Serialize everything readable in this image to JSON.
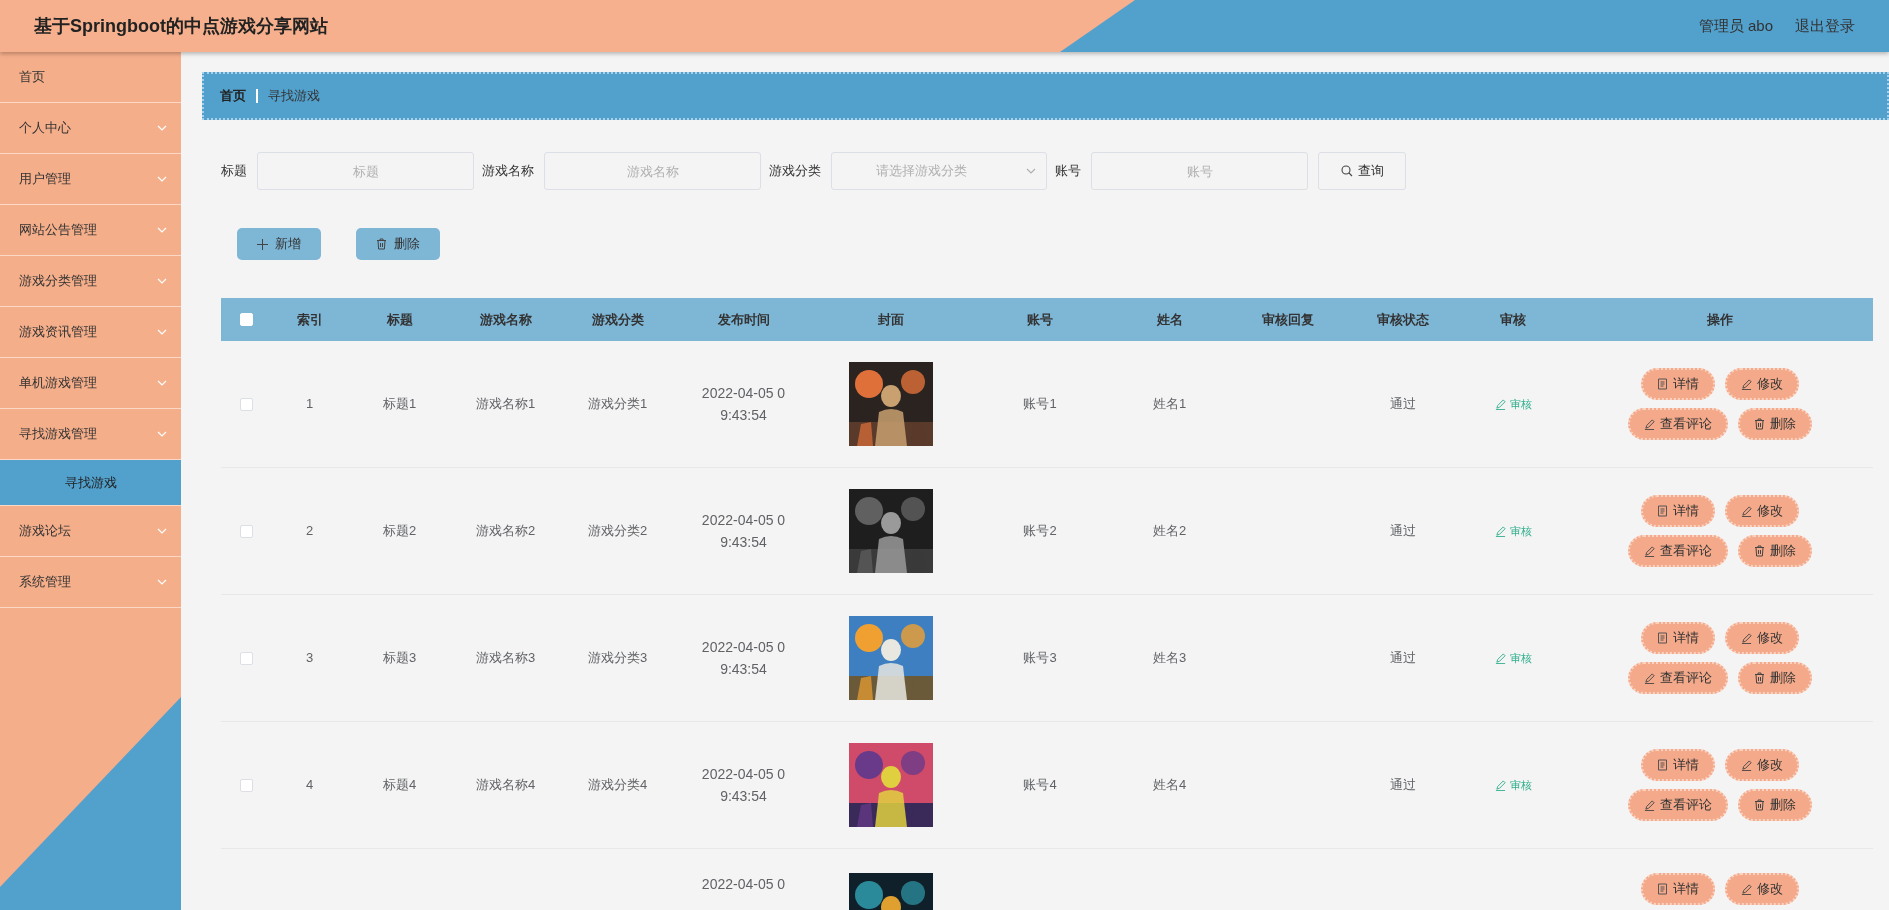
{
  "header": {
    "title": "基于Springboot的中点游戏分享网站",
    "user": "管理员 abo",
    "logout": "退出登录"
  },
  "sidebar": {
    "items": [
      {
        "label": "首页",
        "kind": "link"
      },
      {
        "label": "个人中心",
        "kind": "menu"
      },
      {
        "label": "用户管理",
        "kind": "menu"
      },
      {
        "label": "网站公告管理",
        "kind": "menu"
      },
      {
        "label": "游戏分类管理",
        "kind": "menu"
      },
      {
        "label": "游戏资讯管理",
        "kind": "menu"
      },
      {
        "label": "单机游戏管理",
        "kind": "menu"
      },
      {
        "label": "寻找游戏管理",
        "kind": "menu",
        "children": [
          {
            "label": "寻找游戏",
            "selected": true
          }
        ]
      },
      {
        "label": "游戏论坛",
        "kind": "menu"
      },
      {
        "label": "系统管理",
        "kind": "menu"
      }
    ]
  },
  "breadcrumb": [
    {
      "label": "首页",
      "current": false
    },
    {
      "label": "寻找游戏",
      "current": true
    }
  ],
  "search": {
    "fields": [
      {
        "label": "标题",
        "placeholder": "标题",
        "kind": "input"
      },
      {
        "label": "游戏名称",
        "placeholder": "游戏名称",
        "kind": "input"
      },
      {
        "label": "游戏分类",
        "placeholder": "请选择游戏分类",
        "kind": "select"
      },
      {
        "label": "账号",
        "placeholder": "账号",
        "kind": "input"
      }
    ],
    "button": "查询"
  },
  "actions": [
    {
      "label": "新增",
      "kind": "add"
    },
    {
      "label": "删除",
      "kind": "delete"
    }
  ],
  "table": {
    "select_all_checked": false,
    "columns": [
      "索引",
      "标题",
      "游戏名称",
      "游戏分类",
      "发布时间",
      "封面",
      "账号",
      "姓名",
      "审核回复",
      "审核状态",
      "审核",
      "操作"
    ],
    "rows": [
      {
        "checked": false,
        "index": "1",
        "title": "标题1",
        "name": "游戏名称1",
        "category": "游戏分类1",
        "date_lines": [
          "2022-04-05 0",
          "9:43:54"
        ],
        "cover": {
          "kind": "picture"
        },
        "account": "账号1",
        "person": "姓名1",
        "status": "通过",
        "review": "审核",
        "buttons": [
          {
            "kind": "detail",
            "label": "详情"
          },
          {
            "kind": "edit",
            "label": "修改"
          },
          {
            "kind": "edit",
            "label": "查看评论"
          },
          {
            "kind": "delete",
            "label": "删除"
          }
        ]
      },
      {
        "checked": false,
        "index": "2",
        "title": "标题2",
        "name": "游戏名称2",
        "category": "游戏分类2",
        "date_lines": [
          "2022-04-05 0",
          "9:43:54"
        ],
        "cover": {
          "kind": "picture"
        },
        "account": "账号2",
        "person": "姓名2",
        "status": "通过",
        "review": "审核",
        "buttons": [
          {
            "kind": "detail",
            "label": "详情"
          },
          {
            "kind": "edit",
            "label": "修改"
          },
          {
            "kind": "edit",
            "label": "查看评论"
          },
          {
            "kind": "delete",
            "label": "删除"
          }
        ]
      },
      {
        "checked": false,
        "index": "3",
        "title": "标题3",
        "name": "游戏名称3",
        "category": "游戏分类3",
        "date_lines": [
          "2022-04-05 0",
          "9:43:54"
        ],
        "cover": {
          "kind": "picture"
        },
        "account": "账号3",
        "person": "姓名3",
        "status": "通过",
        "review": "审核",
        "buttons": [
          {
            "kind": "detail",
            "label": "详情"
          },
          {
            "kind": "edit",
            "label": "修改"
          },
          {
            "kind": "edit",
            "label": "查看评论"
          },
          {
            "kind": "delete",
            "label": "删除"
          }
        ]
      },
      {
        "checked": false,
        "index": "4",
        "title": "标题4",
        "name": "游戏名称4",
        "category": "游戏分类4",
        "date_lines": [
          "2022-04-05 0",
          "9:43:54"
        ],
        "cover": {
          "kind": "picture"
        },
        "account": "账号4",
        "person": "姓名4",
        "status": "通过",
        "review": "审核",
        "buttons": [
          {
            "kind": "detail",
            "label": "详情"
          },
          {
            "kind": "edit",
            "label": "修改"
          },
          {
            "kind": "edit",
            "label": "查看评论"
          },
          {
            "kind": "delete",
            "label": "删除"
          }
        ]
      },
      {
        "date_lines": [
          "2022-04-05 0"
        ],
        "cover": {
          "kind": "picture"
        },
        "buttons": [
          {
            "kind": "detail",
            "label": "详情"
          },
          {
            "kind": "edit",
            "label": "修改"
          }
        ]
      }
    ]
  }
}
